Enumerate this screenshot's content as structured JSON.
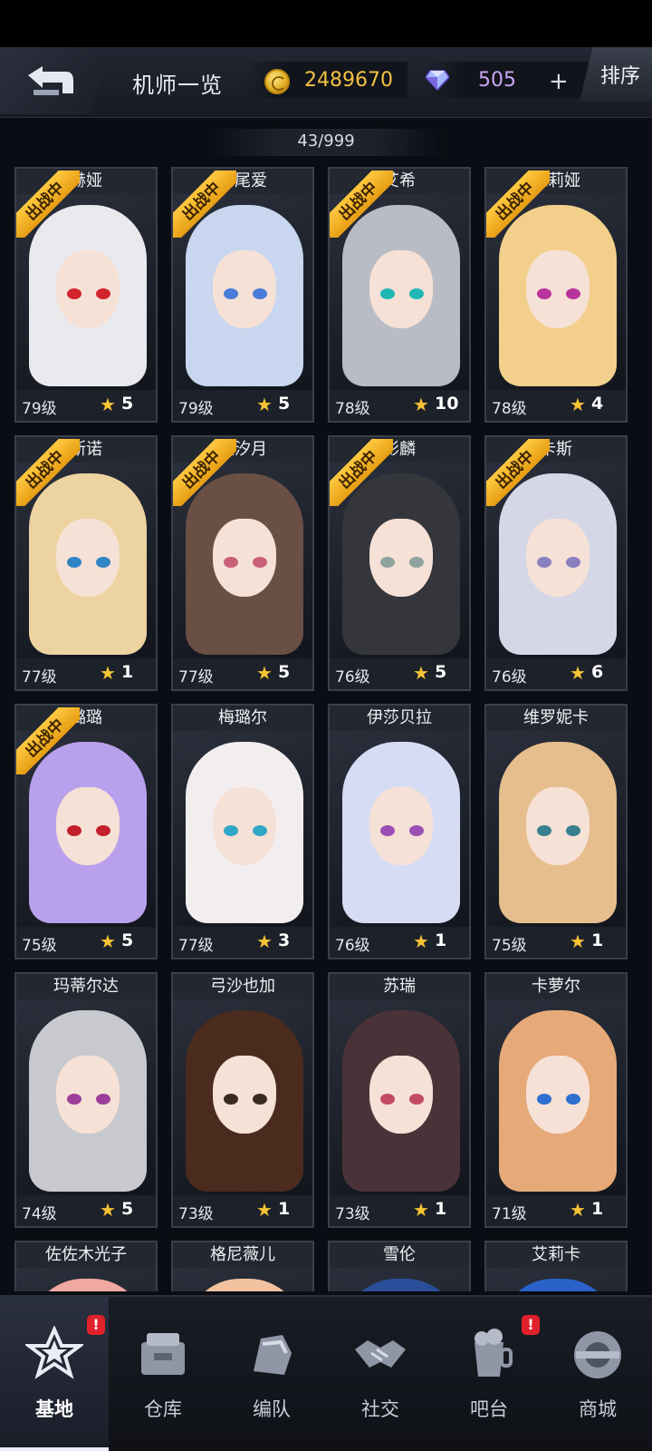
{
  "header": {
    "title": "机师一览",
    "gold": "2489670",
    "gems": "505",
    "plus": "+",
    "sort_label": "排序",
    "colors": {
      "gold": "#f3c043",
      "gem": "#c9a6f2"
    }
  },
  "roster": {
    "count": "43/999",
    "deployed_label": "出战中",
    "pilots": [
      {
        "name": "赫娅",
        "level": "79级",
        "stars": "5",
        "deployed": true,
        "hair": "#e9e9ee",
        "eye": "#d2242c"
      },
      {
        "name": "角尾爱",
        "level": "79级",
        "stars": "5",
        "deployed": true,
        "hair": "#c8d6ef",
        "eye": "#4a7cd8"
      },
      {
        "name": "艾希",
        "level": "78级",
        "stars": "10",
        "deployed": true,
        "hair": "#b9bcc4",
        "eye": "#20b7b6"
      },
      {
        "name": "德莉娅",
        "level": "78级",
        "stars": "4",
        "deployed": true,
        "hair": "#f2cf8a",
        "eye": "#b8339c"
      },
      {
        "name": "斯诺",
        "level": "77级",
        "stars": "1",
        "deployed": true,
        "hair": "#edd3a0",
        "eye": "#2f84c4"
      },
      {
        "name": "濑汐月",
        "level": "77级",
        "stars": "5",
        "deployed": true,
        "hair": "#6a4f45",
        "eye": "#c96078"
      },
      {
        "name": "影麟",
        "level": "76级",
        "stars": "5",
        "deployed": true,
        "hair": "#34363c",
        "eye": "#8fa3a0"
      },
      {
        "name": "卡斯",
        "level": "76级",
        "stars": "6",
        "deployed": true,
        "hair": "#d5d7e6",
        "eye": "#8a7fbf"
      },
      {
        "name": "璐璐",
        "level": "75级",
        "stars": "5",
        "deployed": true,
        "hair": "#b9a0ec",
        "eye": "#c2202a"
      },
      {
        "name": "梅璐尔",
        "level": "77级",
        "stars": "3",
        "deployed": false,
        "hair": "#f2eef0",
        "eye": "#2fa8c8"
      },
      {
        "name": "伊莎贝拉",
        "level": "76级",
        "stars": "1",
        "deployed": false,
        "hair": "#d6dcf4",
        "eye": "#9a4fb6"
      },
      {
        "name": "维罗妮卡",
        "level": "75级",
        "stars": "1",
        "deployed": false,
        "hair": "#e6be8d",
        "eye": "#3a7f8f"
      },
      {
        "name": "玛蒂尔达",
        "level": "74级",
        "stars": "5",
        "deployed": false,
        "hair": "#c8c9ce",
        "eye": "#9b3f9a"
      },
      {
        "name": "弓沙也加",
        "level": "73级",
        "stars": "1",
        "deployed": false,
        "hair": "#4a2b1e",
        "eye": "#3a2a22"
      },
      {
        "name": "苏瑞",
        "level": "73级",
        "stars": "1",
        "deployed": false,
        "hair": "#4a3338",
        "eye": "#c24a62"
      },
      {
        "name": "卡萝尔",
        "level": "71级",
        "stars": "1",
        "deployed": false,
        "hair": "#e6a978",
        "eye": "#2f6fd0"
      },
      {
        "name": "佐佐木光子",
        "level": "",
        "stars": "",
        "deployed": false,
        "hair": "#f0a9a0",
        "eye": "#7a4a4a"
      },
      {
        "name": "格尼薇儿",
        "level": "",
        "stars": "",
        "deployed": false,
        "hair": "#f2c2a0",
        "eye": "#7a4a4a"
      },
      {
        "name": "雪伦",
        "level": "",
        "stars": "",
        "deployed": false,
        "hair": "#2a4e9a",
        "eye": "#2a4e9a"
      },
      {
        "name": "艾莉卡",
        "level": "",
        "stars": "",
        "deployed": false,
        "hair": "#2a62c8",
        "eye": "#2a62c8"
      }
    ]
  },
  "nav": {
    "items": [
      {
        "label": "基地",
        "icon": "base-icon",
        "active": true,
        "badge": "!"
      },
      {
        "label": "仓库",
        "icon": "warehouse-icon",
        "active": false,
        "badge": ""
      },
      {
        "label": "编队",
        "icon": "formation-icon",
        "active": false,
        "badge": ""
      },
      {
        "label": "社交",
        "icon": "handshake-icon",
        "active": false,
        "badge": ""
      },
      {
        "label": "吧台",
        "icon": "bar-drink-icon",
        "active": false,
        "badge": "!"
      },
      {
        "label": "商城",
        "icon": "shop-icon",
        "active": false,
        "badge": ""
      }
    ]
  }
}
